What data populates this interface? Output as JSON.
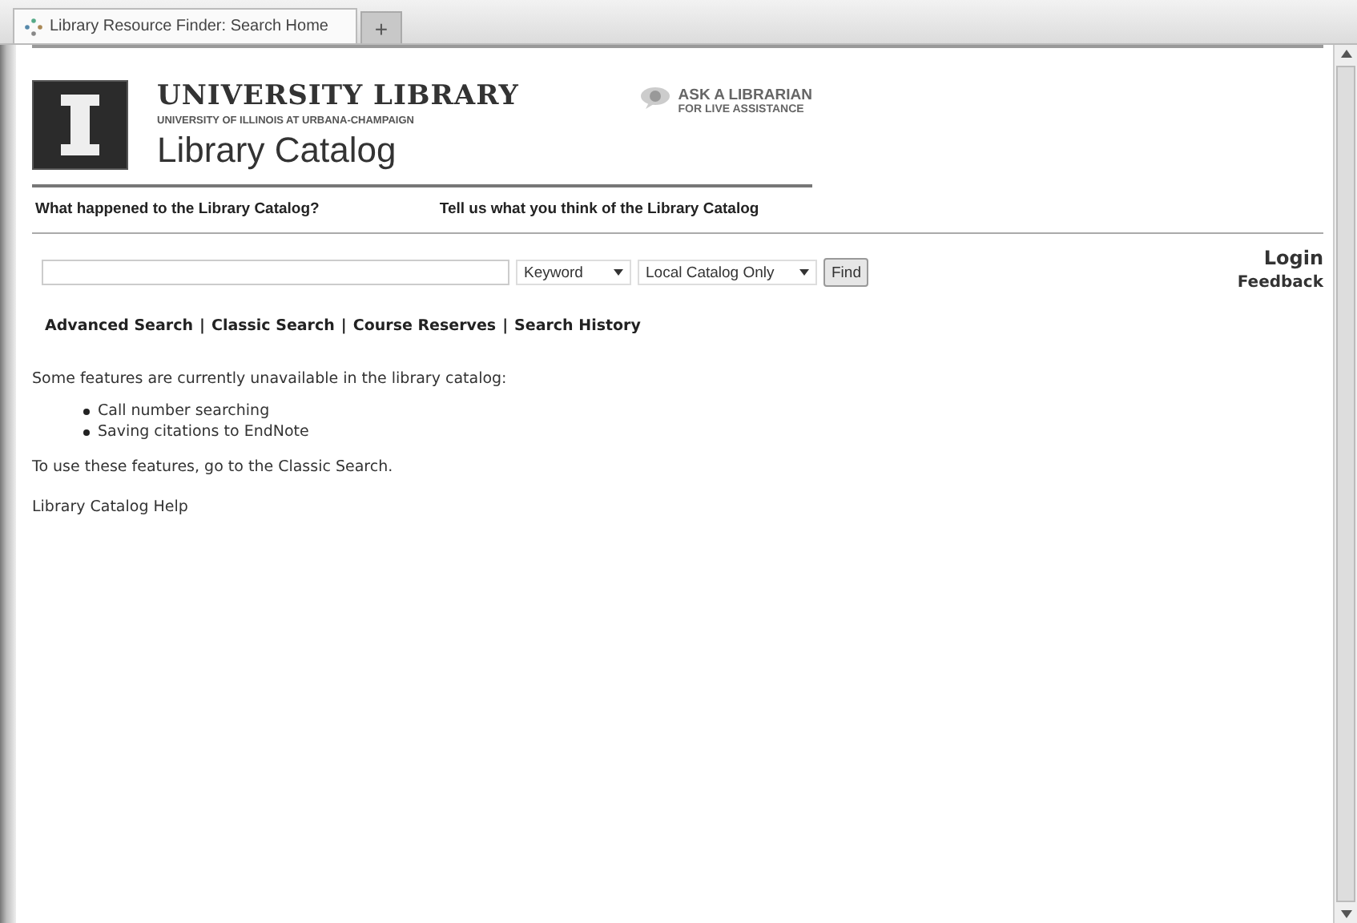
{
  "browser": {
    "tabs": [
      {
        "label": "Library Resource Finder: Search Home",
        "selected": true
      }
    ],
    "new_tab": "+"
  },
  "header": {
    "title": "UNIVERSITY LIBRARY",
    "subtitle": "UNIVERSITY OF ILLINOIS AT URBANA-CHAMPAIGN",
    "catalog": "Library Catalog",
    "ask": {
      "line1": "ASK A LIBRARIAN",
      "line2": "FOR LIVE ASSISTANCE"
    }
  },
  "header_links": [
    "What happened to the Library Catalog?",
    "Tell us what you think of the Library Catalog"
  ],
  "search": {
    "scope": "Keyword",
    "source": "Local Catalog Only",
    "button": "Find"
  },
  "account": {
    "login": "Login",
    "feedback": "Feedback"
  },
  "nav": {
    "separator": "|",
    "links": [
      "Advanced Search",
      "Classic Search",
      "Course Reserves",
      "Search History"
    ]
  },
  "notice": {
    "intro": "Some features are currently unavailable in the library catalog:",
    "items": [
      "Call number searching",
      "Saving citations to EndNote"
    ],
    "outro": "To use these features, go to the Classic Search."
  },
  "help": "Library Catalog Help"
}
